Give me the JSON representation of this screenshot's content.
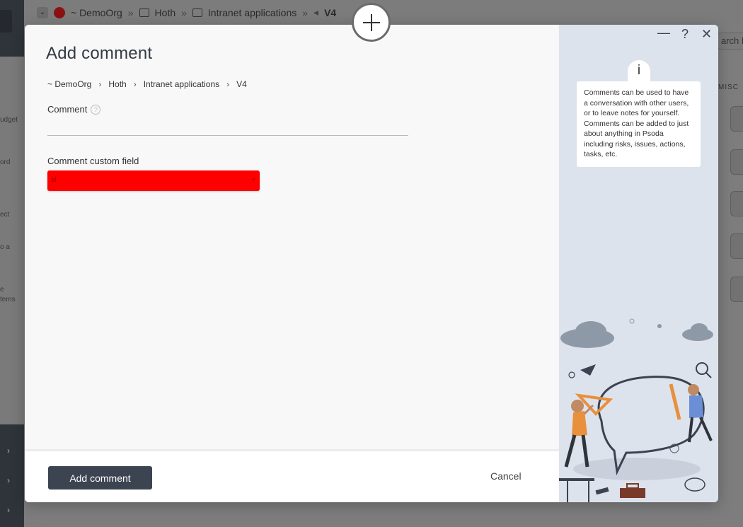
{
  "background": {
    "breadcrumb": [
      "~ DemoOrg",
      "Hoth",
      "Intranet applications",
      "V4"
    ],
    "sidebar_fragments": [
      "udget",
      "ord",
      "ect",
      "o a",
      "e",
      "tems"
    ],
    "search_placeholder": "arch P",
    "misc_label": "MISC"
  },
  "modal": {
    "title": "Add comment",
    "breadcrumb": [
      "~ DemoOrg",
      "Hoth",
      "Intranet applications",
      "V4"
    ],
    "fields": {
      "comment_label": "Comment",
      "comment_value": "",
      "custom_field_label": "Comment custom field",
      "custom_field_value": "al"
    },
    "footer": {
      "submit_label": "Add comment",
      "cancel_label": "Cancel"
    },
    "window_controls": {
      "minimize": "—",
      "help": "?",
      "close": "✕"
    },
    "info": {
      "icon": "i",
      "text": "Comments can be used to have a conversation with other users, or to leave notes for yourself. Comments can be added to just about anything in Psoda including risks, issues, actions, tasks, etc."
    }
  },
  "colors": {
    "primary_button": "#3c4452",
    "custom_field_bg": "#ff0000",
    "side_panel": "#dde3ec"
  }
}
